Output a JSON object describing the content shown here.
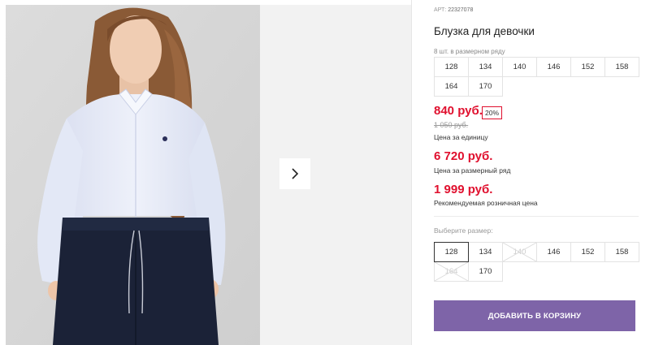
{
  "product": {
    "article_prefix": "АРТ:",
    "article_number": "22327078",
    "title": "Блузка для девочки"
  },
  "pack": {
    "label": "8 шт. в размерном ряду",
    "sizes": [
      "128",
      "134",
      "140",
      "146",
      "152",
      "158",
      "164",
      "170"
    ]
  },
  "pricing": {
    "unit_price": "840 руб.",
    "discount": "20%",
    "old_price": "1 050 руб.",
    "unit_label": "Цена за единицу",
    "pack_price": "6 720 руб.",
    "pack_label": "Цена за размерный ряд",
    "rrp_price": "1 999 руб.",
    "rrp_label": "Рекомендуемая розничная цена"
  },
  "size_select": {
    "label": "Выберите размер:",
    "sizes": [
      {
        "value": "128",
        "state": "selected"
      },
      {
        "value": "134",
        "state": "available"
      },
      {
        "value": "140",
        "state": "unavailable"
      },
      {
        "value": "146",
        "state": "available"
      },
      {
        "value": "152",
        "state": "available"
      },
      {
        "value": "158",
        "state": "available"
      },
      {
        "value": "164",
        "state": "unavailable"
      },
      {
        "value": "170",
        "state": "available"
      }
    ]
  },
  "actions": {
    "add_to_cart": "ДОБАВИТЬ В КОРЗИНУ"
  },
  "gallery": {
    "next_icon": "chevron-right-icon"
  },
  "colors": {
    "price": "#e0102e",
    "button": "#7e64a8",
    "shirt": "#e8ecf7",
    "pants": "#1a2238"
  }
}
